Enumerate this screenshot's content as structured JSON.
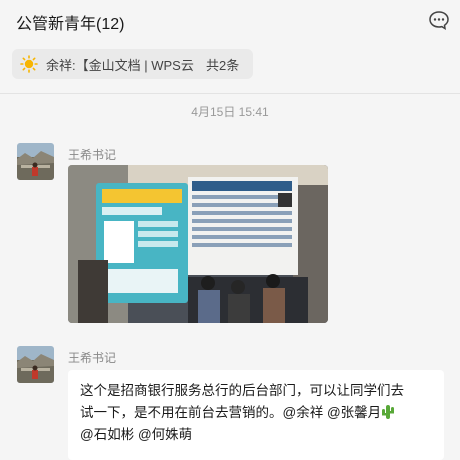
{
  "header": {
    "title": "公管新青年(12)"
  },
  "pinned": {
    "text": "余祥:【金山文档 | WPS云…",
    "count": "共2条"
  },
  "messages": {
    "timestamp": "4月15日 15:41",
    "items": [
      {
        "sender": "王希书记",
        "type": "image"
      },
      {
        "sender": "王希书记",
        "type": "text",
        "line1": "这个是招商银行服务总行的后台部门，可以让同学们去",
        "line2a": "试一下，是不用在前台去营销的。@余祥 @张馨月",
        "line3": "@石如彬 @何姝萌"
      }
    ]
  },
  "icons": {
    "more": "chat-bubble-more-icon",
    "pinned": "sun-icon",
    "emoji": "cactus-icon"
  },
  "colors": {
    "background": "#f5f5f5",
    "bubble": "#ffffff",
    "pinned_bar": "#eaeaea",
    "muted_text": "#999999"
  }
}
